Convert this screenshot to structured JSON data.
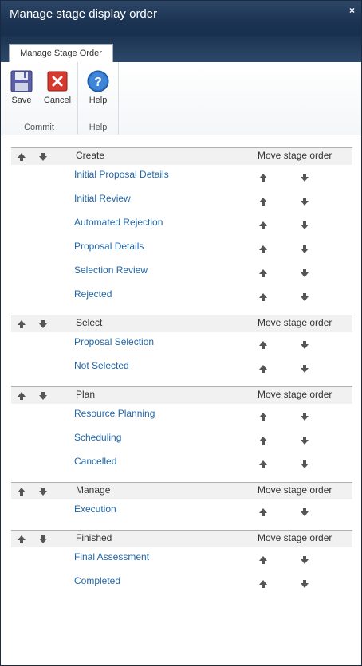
{
  "window": {
    "title": "Manage stage display order",
    "close_glyph": "×"
  },
  "ribbon": {
    "tab_label": "Manage Stage Order",
    "groups": [
      {
        "label": "Commit",
        "buttons": [
          {
            "label": "Save",
            "icon": "save-icon"
          },
          {
            "label": "Cancel",
            "icon": "cancel-icon"
          }
        ]
      },
      {
        "label": "Help",
        "buttons": [
          {
            "label": "Help",
            "icon": "help-icon"
          }
        ]
      }
    ]
  },
  "colors": {
    "link": "#2167a8",
    "title_bar": "#1c3352",
    "header_bg": "#f1f1f1",
    "arrow": "#555555"
  },
  "column_label": "Move stage order",
  "stages": [
    {
      "name": "Create",
      "items": [
        "Initial Proposal Details",
        "Initial Review",
        "Automated Rejection",
        "Proposal Details",
        "Selection Review",
        "Rejected"
      ]
    },
    {
      "name": "Select",
      "items": [
        "Proposal Selection",
        "Not Selected"
      ]
    },
    {
      "name": "Plan",
      "items": [
        "Resource Planning",
        "Scheduling",
        "Cancelled"
      ]
    },
    {
      "name": "Manage",
      "items": [
        "Execution"
      ]
    },
    {
      "name": "Finished",
      "items": [
        "Final Assessment",
        "Completed"
      ]
    }
  ]
}
